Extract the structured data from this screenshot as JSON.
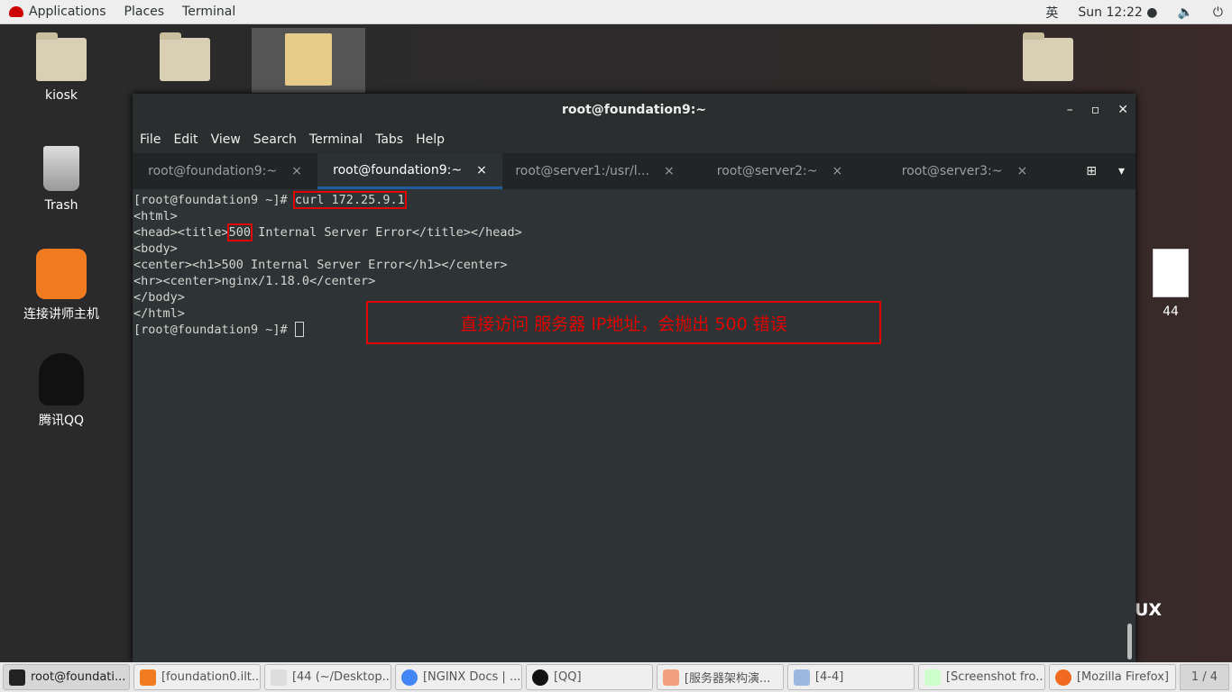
{
  "topbar": {
    "applications": "Applications",
    "places": "Places",
    "terminal": "Terminal",
    "input_method": "英",
    "clock": "Sun 12:22 ●",
    "volume_icon": "volume-icon",
    "power_icon": "power-icon"
  },
  "desktop": {
    "icons": [
      {
        "label": "kiosk"
      },
      {
        "label": ""
      },
      {
        "label": ""
      },
      {
        "label": ""
      },
      {
        "label": "Trash"
      },
      {
        "label": "连接讲师主机"
      },
      {
        "label": "腾讯QQ"
      },
      {
        "label": "44"
      }
    ],
    "watermark": "UX"
  },
  "window": {
    "title": "root@foundation9:~",
    "menu": [
      "File",
      "Edit",
      "View",
      "Search",
      "Terminal",
      "Tabs",
      "Help"
    ],
    "tabs": [
      {
        "label": "root@foundation9:~",
        "active": false
      },
      {
        "label": "root@foundation9:~",
        "active": true
      },
      {
        "label": "root@server1:/usr/l...",
        "active": false
      },
      {
        "label": "root@server2:~",
        "active": false
      },
      {
        "label": "root@server3:~",
        "active": false
      }
    ],
    "close_glyph": "×"
  },
  "terminal": {
    "prompt": "[root@foundation9 ~]# ",
    "command": "curl 172.25.9.1",
    "lines": [
      "<html>",
      "<head><title>",
      "500",
      " Internal Server Error</title></head>",
      "<body>",
      "<center><h1>500 Internal Server Error</h1></center>",
      "<hr><center>nginx/1.18.0</center>",
      "</body>",
      "</html>"
    ]
  },
  "annotation": {
    "text": "直接访问 服务器 IP地址，会抛出 500 错误",
    "color": "#e00000"
  },
  "taskbar": {
    "items": [
      {
        "label": "root@foundati...",
        "active": true,
        "color": "#222"
      },
      {
        "label": "[foundation0.ilt....",
        "color": "#f07b20"
      },
      {
        "label": "[44 (~/Desktop...",
        "color": "#ddd"
      },
      {
        "label": "[NGINX Docs | ...",
        "color": "#4285f4"
      },
      {
        "label": "[QQ]",
        "color": "#111"
      },
      {
        "label": "[服务器架构演...",
        "color": "#f0a080"
      },
      {
        "label": "[4-4]",
        "color": "#9ab8e0"
      },
      {
        "label": "[Screenshot fro...",
        "color": "#cfc"
      },
      {
        "label": "[Mozilla Firefox]",
        "color": "#f06a20"
      }
    ],
    "pager": "1 / 4"
  }
}
